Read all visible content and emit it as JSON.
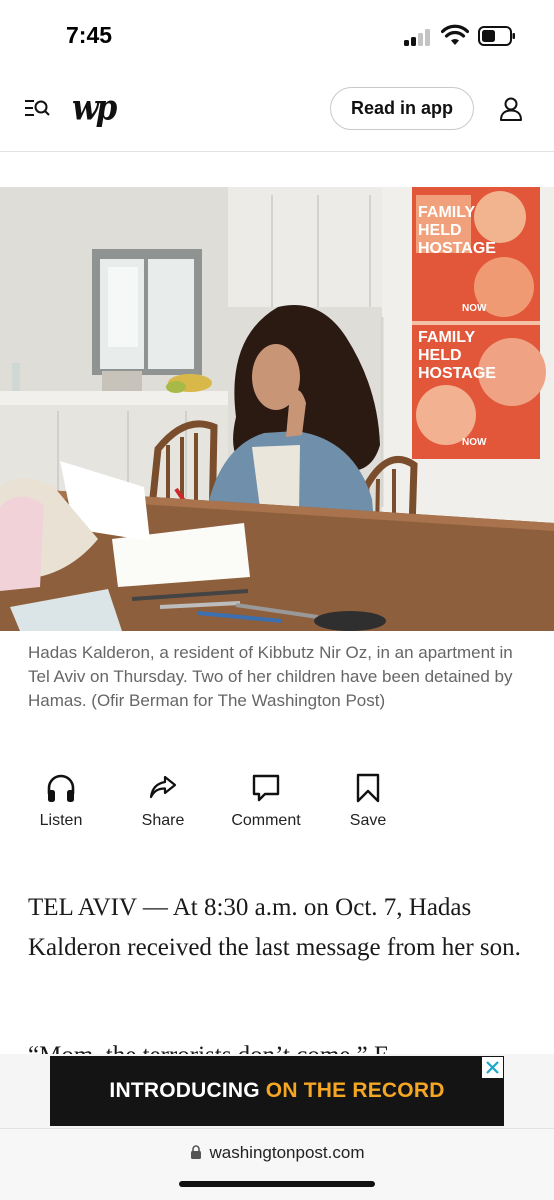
{
  "status_bar": {
    "time": "7:45"
  },
  "header": {
    "logo": "wp",
    "read_in_app": "Read in app"
  },
  "photo": {
    "poster_text_1": "FAMILY HELD HOSTAGE",
    "poster_text_2": "NOW"
  },
  "caption": "Hadas Kalderon, a resident of Kibbutz Nir Oz, in an apartment in Tel Aviv on Thursday. Two of her children have been detained by Hamas. (Ofir Berman for The Washington Post)",
  "actions": [
    {
      "label": "Listen",
      "icon": "headphones-icon"
    },
    {
      "label": "Share",
      "icon": "share-icon"
    },
    {
      "label": "Comment",
      "icon": "comment-icon"
    },
    {
      "label": "Save",
      "icon": "bookmark-icon"
    }
  ],
  "article": {
    "lead": "TEL AVIV — At 8:30 a.m. on Oct. 7, Hadas Kalderon received the last message from her son.",
    "next_partial": "“Mom, the terrorists don’t come,” E..."
  },
  "ad": {
    "part1": "INTRODUCING",
    "part2": "ON THE RECORD"
  },
  "url_bar": {
    "domain": "washingtonpost.com"
  },
  "colors": {
    "ad_accent": "#f5a623",
    "ad_close": "#1aa6c8",
    "poster_red": "#e2563a"
  }
}
